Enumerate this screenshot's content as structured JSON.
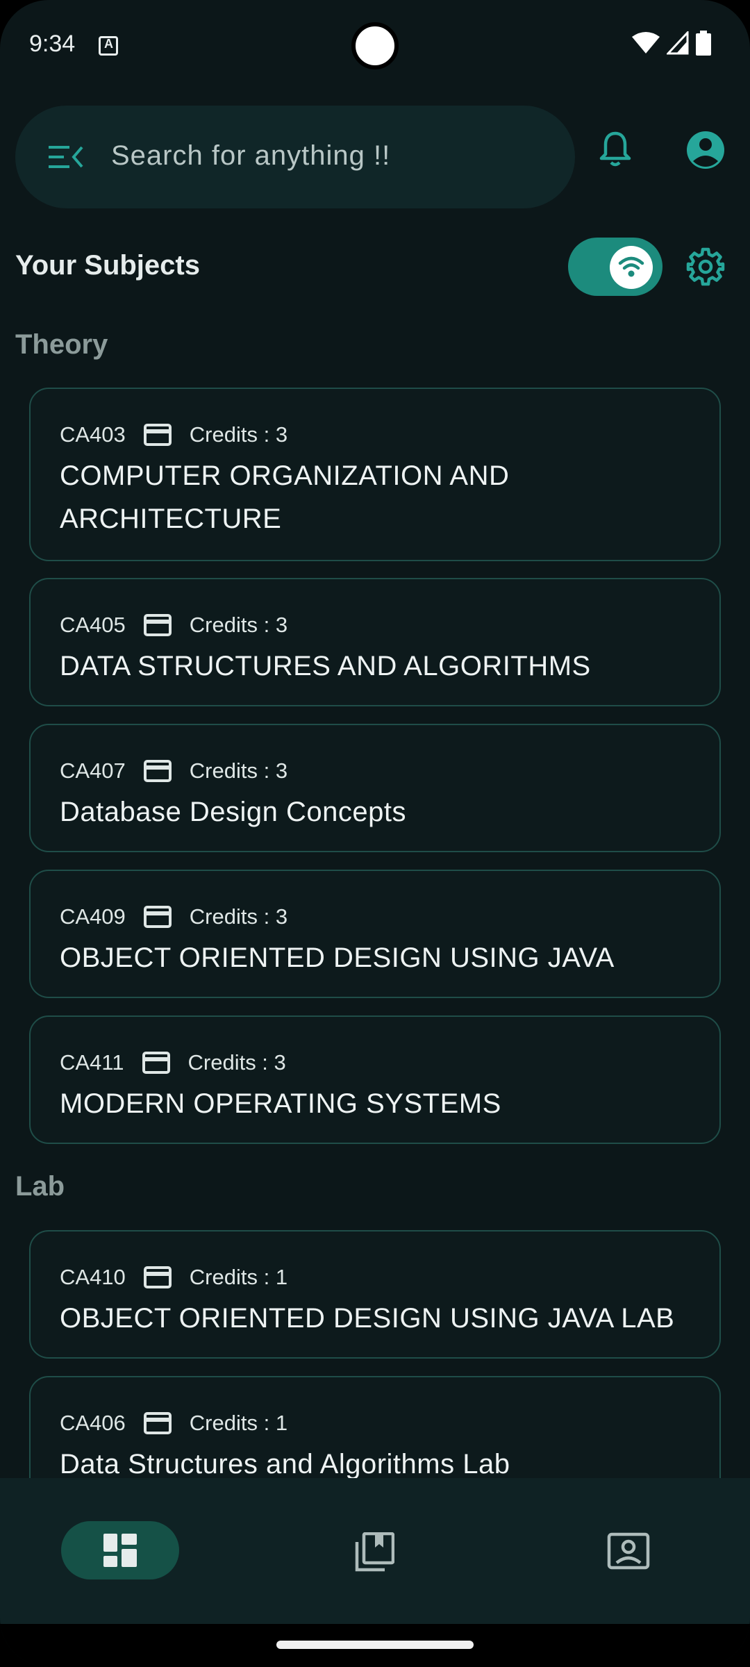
{
  "status": {
    "time": "9:34"
  },
  "search": {
    "placeholder": "Search for anything !!"
  },
  "header": {
    "title": "Your Subjects"
  },
  "sections": {
    "theory": "Theory",
    "lab": "Lab"
  },
  "cards": [
    {
      "code": "CA403",
      "credits": "Credits : 3",
      "title": "COMPUTER ORGANIZATION AND ARCHITECTURE"
    },
    {
      "code": "CA405",
      "credits": "Credits : 3",
      "title": "DATA STRUCTURES AND ALGORITHMS"
    },
    {
      "code": "CA407",
      "credits": "Credits : 3",
      "title": "Database Design Concepts"
    },
    {
      "code": "CA409",
      "credits": "Credits : 3",
      "title": "OBJECT ORIENTED DESIGN USING JAVA"
    },
    {
      "code": "CA411",
      "credits": "Credits : 3",
      "title": "MODERN OPERATING SYSTEMS"
    },
    {
      "code": "CA410",
      "credits": "Credits : 1",
      "title": "OBJECT ORIENTED DESIGN USING JAVA LAB"
    },
    {
      "code": "CA406",
      "credits": "Credits : 1",
      "title": "Data Structures and Algorithms Lab"
    }
  ],
  "icons": {
    "menu": "menu-collapse-icon",
    "bell": "bell-icon",
    "account": "account-circle-icon",
    "wifi": "wifi-icon",
    "settings": "gear-icon",
    "card": "credit-card-icon",
    "dashboard": "dashboard-icon",
    "library": "library-books-icon",
    "profile": "contact-card-icon"
  },
  "colors": {
    "accent": "#26a69a",
    "background": "#0c1719",
    "card_border": "#1f4d48",
    "toggle_on": "#1c8b7d"
  },
  "toggle": {
    "offline_mode_on": true
  }
}
